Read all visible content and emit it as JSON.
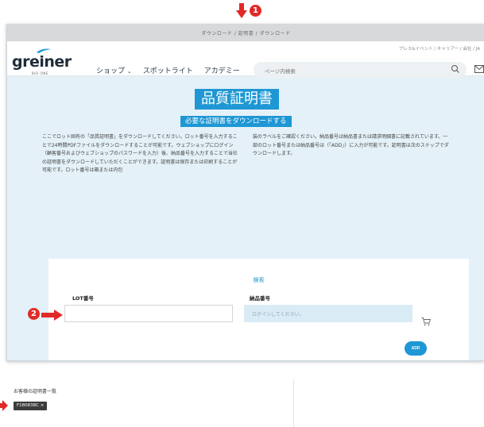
{
  "annotations": {
    "marker_1": "1",
    "marker_2": "2"
  },
  "breadcrumb": "ダウンロード / 証明書 / ダウンロード",
  "header": {
    "utility_links": "プレス&イベント / キャリアー / 会社 / JA",
    "logo_text": "greiner",
    "logo_sub": "BIO-ONE",
    "nav": [
      {
        "label": "ショップ",
        "has_dropdown": true
      },
      {
        "label": "スポットライト",
        "has_dropdown": false
      },
      {
        "label": "アカデミー",
        "has_dropdown": false
      }
    ],
    "search_placeholder": "ページ内検索"
  },
  "hero": {
    "title": "品質証明書",
    "subtitle": "必要な証明書をダウンロードする"
  },
  "description": {
    "left": "ここでロット固有の「品質証明書」をダウンロードしてください。ロット番号を入力することで24時間PDFファイルをダウンロードすることが可能です。ウェブショップにログイン（顧客番号およびウェブショップのパスワードを入力）後、納品番号を入力することで当社の証明書をダウンロードしていただくことができます。証明書は保存または印刷することが可能です。ロット番号は箱または内包",
    "right": "装のラベルをご確認ください。納品番号は納品書または請求明細書に記載されています。一部のロット番号または納品番号は（「ADD」）に入力が可能です。証明書は次のステップでダウンロードします。"
  },
  "form": {
    "title": "検索",
    "lot_label": "LOT番号",
    "lot_value": "",
    "delivery_label": "納品番号",
    "delivery_placeholder": "ログインしてください。",
    "add_label": "ADD"
  },
  "list": {
    "title": "お客様の証明書一覧",
    "tags": [
      "F180838C ×"
    ]
  },
  "colors": {
    "accent": "#1e97d4",
    "annotation": "#e02a28",
    "page_bg": "#e4f1f8"
  }
}
